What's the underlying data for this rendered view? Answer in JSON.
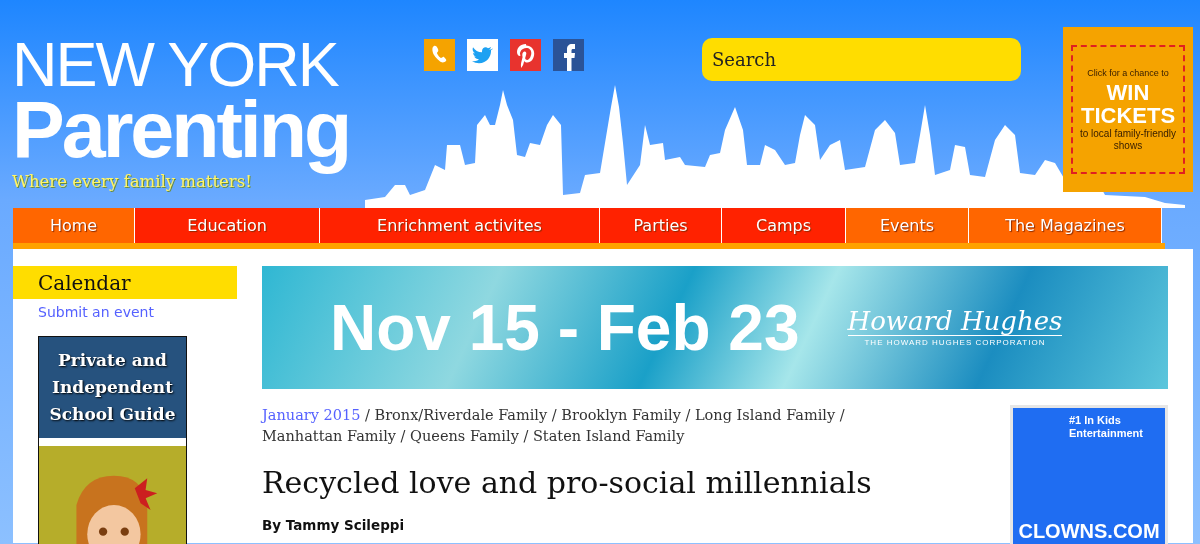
{
  "header": {
    "logo_line1": "NEW YORK",
    "logo_line2": "Parenting",
    "tagline": "Where every family matters!",
    "social": [
      {
        "kind": "phone",
        "color": "#f5a300"
      },
      {
        "kind": "twitter",
        "color": "#ffffff"
      },
      {
        "kind": "pinterest",
        "color": "#e8332e"
      },
      {
        "kind": "facebook",
        "color": "#2b5397"
      }
    ],
    "search": {
      "placeholder": "Search"
    },
    "ticket_ad": {
      "line1": "Click for a chance to",
      "headline1": "WIN",
      "headline2": "TICKETS",
      "line2": "to local family-friendly shows"
    }
  },
  "nav": [
    {
      "label": "Home",
      "color": "#ff6600"
    },
    {
      "label": "Education",
      "color": "#ff2200"
    },
    {
      "label": "Enrichment activites",
      "color": "#ff2200"
    },
    {
      "label": "Parties",
      "color": "#ff2200"
    },
    {
      "label": "Camps",
      "color": "#ff2200"
    },
    {
      "label": "Events",
      "color": "#ff6600"
    },
    {
      "label": "The Magazines",
      "color": "#ff6600"
    }
  ],
  "sidebar": {
    "title": "Calendar",
    "link": "Submit an event",
    "guide_ad": "Private and Independent School Guide"
  },
  "banner": {
    "dates": "Nov 15 - Feb 23",
    "brand": "Howard Hughes",
    "brand_sub": "THE HOWARD HUGHES CORPORATION"
  },
  "article": {
    "separator": "/",
    "categories": [
      {
        "label": "January 2015",
        "kind": "date"
      },
      {
        "label": "Bronx/Riverdale Family",
        "kind": "region"
      },
      {
        "label": "Brooklyn Family",
        "kind": "region"
      },
      {
        "label": "Long Island Family",
        "kind": "region"
      },
      {
        "label": "Manhattan Family",
        "kind": "region"
      },
      {
        "label": "Queens Family",
        "kind": "region"
      },
      {
        "label": "Staten Island Family",
        "kind": "region"
      }
    ],
    "title": "Recycled love and pro-social millennials",
    "byline": "By Tammy Scileppi"
  },
  "side_ad": {
    "rank": "#1",
    "line": "In Kids Entertainment",
    "site": "CLOWNS.COM"
  }
}
